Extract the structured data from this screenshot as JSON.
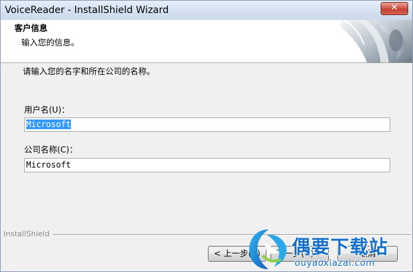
{
  "window": {
    "title": "VoiceReader - InstallShield Wizard",
    "close_glyph": "✕"
  },
  "header": {
    "title": "客户信息",
    "subtitle": "输入您的信息。",
    "art_icon": "installshield-header-art-icon"
  },
  "body": {
    "instruction": "请输入您的名字和所在公司的名称。",
    "user_label": "用户名(U)：",
    "user_value": "Microsoft",
    "company_label": "公司名称(C)：",
    "company_value": "Microsoft"
  },
  "footer": {
    "brand": "InstallShield",
    "back_label": "< 上一步(B)",
    "next_label": "下一步(N) >",
    "cancel_label": "取消"
  },
  "watermark": {
    "text": "偶要下载站",
    "url": "ouyaoxiazai.com",
    "logo_icon": "watermark-logo-icon"
  },
  "colors": {
    "selection": "#3399ff",
    "watermark": "#1670c8",
    "titlebar": "#d6e2f1",
    "close": "#c3402f"
  }
}
